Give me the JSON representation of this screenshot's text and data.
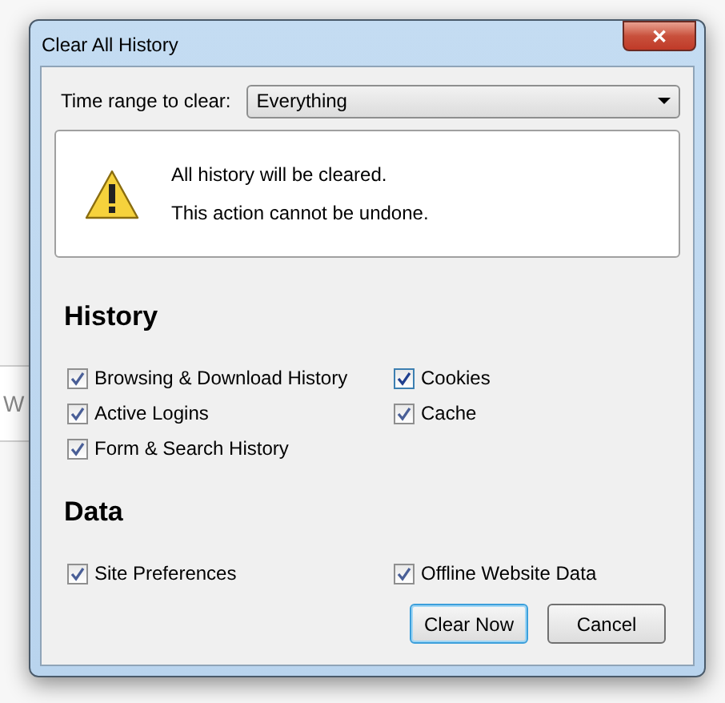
{
  "background": {
    "fragment": "W"
  },
  "window": {
    "title": "Clear All History",
    "close": "✕"
  },
  "time_range": {
    "label": "Time range to clear:",
    "value": "Everything"
  },
  "warning": {
    "lines": [
      "All history will be cleared.",
      "This action cannot be undone."
    ]
  },
  "sections": [
    {
      "title": "History",
      "items": [
        {
          "label": "Browsing & Download History",
          "checked": true,
          "focused": false
        },
        {
          "label": "Cookies",
          "checked": true,
          "focused": true
        },
        {
          "label": "Active Logins",
          "checked": true,
          "focused": false
        },
        {
          "label": "Cache",
          "checked": true,
          "focused": false
        },
        {
          "label": "Form & Search History",
          "checked": true,
          "focused": false
        }
      ]
    },
    {
      "title": "Data",
      "items": [
        {
          "label": "Site Preferences",
          "checked": true,
          "focused": false
        },
        {
          "label": "Offline Website Data",
          "checked": true,
          "focused": false
        }
      ]
    }
  ],
  "buttons": [
    {
      "label": "Clear Now",
      "default": true
    },
    {
      "label": "Cancel",
      "default": false
    }
  ]
}
